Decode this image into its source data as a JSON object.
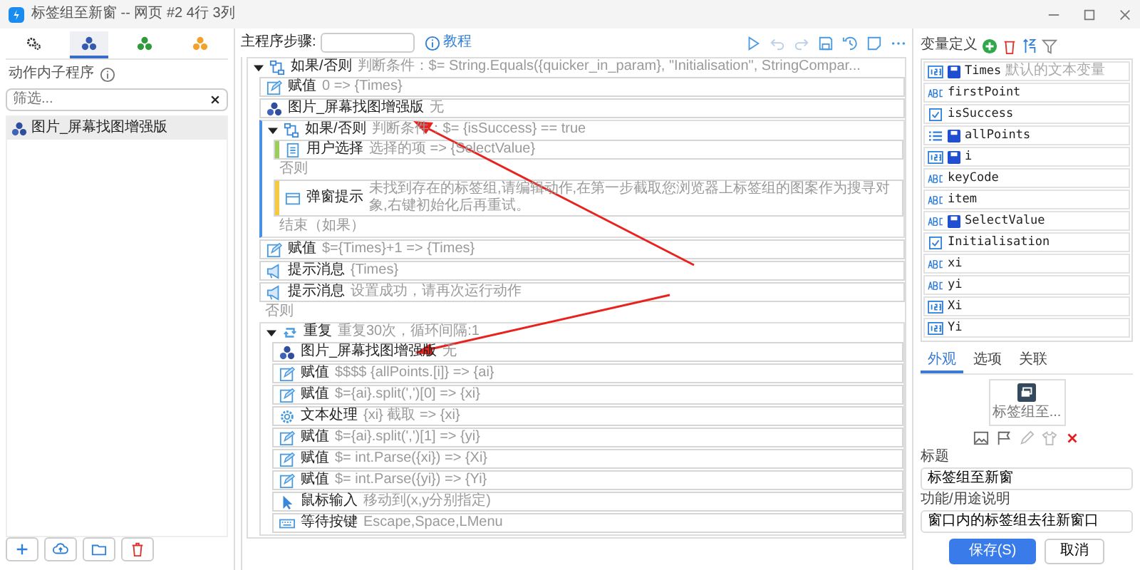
{
  "window": {
    "title": "标签组至新窗 -- 网页 #2 4行 3列"
  },
  "left_tabs": [
    {
      "kind": "gear",
      "selected": false
    },
    {
      "kind": "cluster",
      "color": "#3558b0",
      "selected": true
    },
    {
      "kind": "cluster",
      "color": "#2f9a3c",
      "selected": false
    },
    {
      "kind": "cluster",
      "color": "#f2a22a",
      "selected": false
    }
  ],
  "subprograms": {
    "label": "动作内子程序",
    "search": {
      "placeholder": "筛选..."
    },
    "items": [
      {
        "name": "图片_屏幕找图增强版",
        "selected": true
      }
    ]
  },
  "main": {
    "label": "主程序步骤:",
    "tutorial": "教程",
    "steps": [
      {
        "kind": "branch",
        "title": "如果/否则",
        "detail": "判断条件：$= String.Equals({quicker_in_param}, \"Initialisation\", StringCompar...",
        "expanded": true,
        "children": [
          {
            "kind": "assign",
            "title": "赋值",
            "detail": "0 => {Times}"
          },
          {
            "kind": "image",
            "title": "图片_屏幕找图增强版",
            "detail": "无"
          },
          {
            "kind": "branch",
            "title": "如果/否则",
            "detail": "判断条件：$= {isSuccess} == true",
            "expanded": true,
            "children": [
              {
                "kind": "choose",
                "title": "用户选择",
                "detail": "选择的项 => {SelectValue}",
                "color": "#9ccc5a"
              },
              {
                "kind": "label",
                "title": "否则"
              },
              {
                "kind": "popup",
                "title": "弹窗提示",
                "detail": "未找到存在的标签组,请编辑动作,在第一步截取您浏览器上标签组的图案作为搜寻对象,右键初始化后再重试。",
                "color": "#f5c842"
              },
              {
                "kind": "label",
                "title": "结束（如果）"
              }
            ]
          },
          {
            "kind": "assign",
            "title": "赋值",
            "detail": "$={Times}+1 => {Times}"
          },
          {
            "kind": "message",
            "title": "提示消息",
            "detail": "{Times}"
          },
          {
            "kind": "message",
            "title": "提示消息",
            "detail": "设置成功，请再次运行动作"
          },
          {
            "kind": "label",
            "title": "否则"
          },
          {
            "kind": "loop",
            "title": "重复",
            "detail": "重复30次，循环间隔:1",
            "expanded": true,
            "children": [
              {
                "kind": "image",
                "title": "图片_屏幕找图增强版",
                "detail": "无"
              },
              {
                "kind": "assign",
                "title": "赋值",
                "detail": "$$$$ {allPoints.[i]} => {ai}"
              },
              {
                "kind": "assign",
                "title": "赋值",
                "detail": "$={ai}.split(',')[0] => {xi}"
              },
              {
                "kind": "text",
                "title": "文本处理",
                "detail": "{xi} 截取 => {xi}"
              },
              {
                "kind": "assign",
                "title": "赋值",
                "detail": "$={ai}.split(',')[1] => {yi}"
              },
              {
                "kind": "assign",
                "title": "赋值",
                "detail": "$= int.Parse({xi}) => {Xi}"
              },
              {
                "kind": "assign",
                "title": "赋值",
                "detail": "$= int.Parse({yi}) => {Yi}"
              },
              {
                "kind": "mouse",
                "title": "鼠标输入",
                "detail": "移动到(x,y分别指定)"
              },
              {
                "kind": "key",
                "title": "等待按键",
                "detail": "Escape,Space,LMenu"
              }
            ]
          }
        ]
      }
    ]
  },
  "variables": {
    "title": "变量定义",
    "items": [
      {
        "kind": "number",
        "saved": true,
        "name": "Times",
        "description": "默认的文本变量"
      },
      {
        "kind": "text",
        "saved": false,
        "name": "firstPoint"
      },
      {
        "kind": "bool",
        "saved": false,
        "name": "isSuccess"
      },
      {
        "kind": "list",
        "saved": true,
        "name": "allPoints"
      },
      {
        "kind": "number",
        "saved": true,
        "name": "i"
      },
      {
        "kind": "text",
        "saved": false,
        "name": "keyCode"
      },
      {
        "kind": "text",
        "saved": false,
        "name": "item"
      },
      {
        "kind": "text",
        "saved": true,
        "name": "SelectValue"
      },
      {
        "kind": "bool",
        "saved": false,
        "name": "Initialisation"
      },
      {
        "kind": "text",
        "saved": false,
        "name": "xi"
      },
      {
        "kind": "text",
        "saved": false,
        "name": "yi"
      },
      {
        "kind": "number",
        "saved": false,
        "name": "Xi"
      },
      {
        "kind": "number",
        "saved": false,
        "name": "Yi"
      }
    ]
  },
  "props": {
    "tabs": [
      {
        "label": "外观",
        "selected": true
      },
      {
        "label": "选项",
        "selected": false
      },
      {
        "label": "关联",
        "selected": false
      }
    ],
    "tile_label": "标签组至...",
    "title_label": "标题",
    "title_value": "标签组至新窗",
    "desc_label": "功能/用途说明",
    "desc_value": "窗口内的标签组去往新窗口",
    "save": "保存(S)",
    "cancel": "取消"
  }
}
